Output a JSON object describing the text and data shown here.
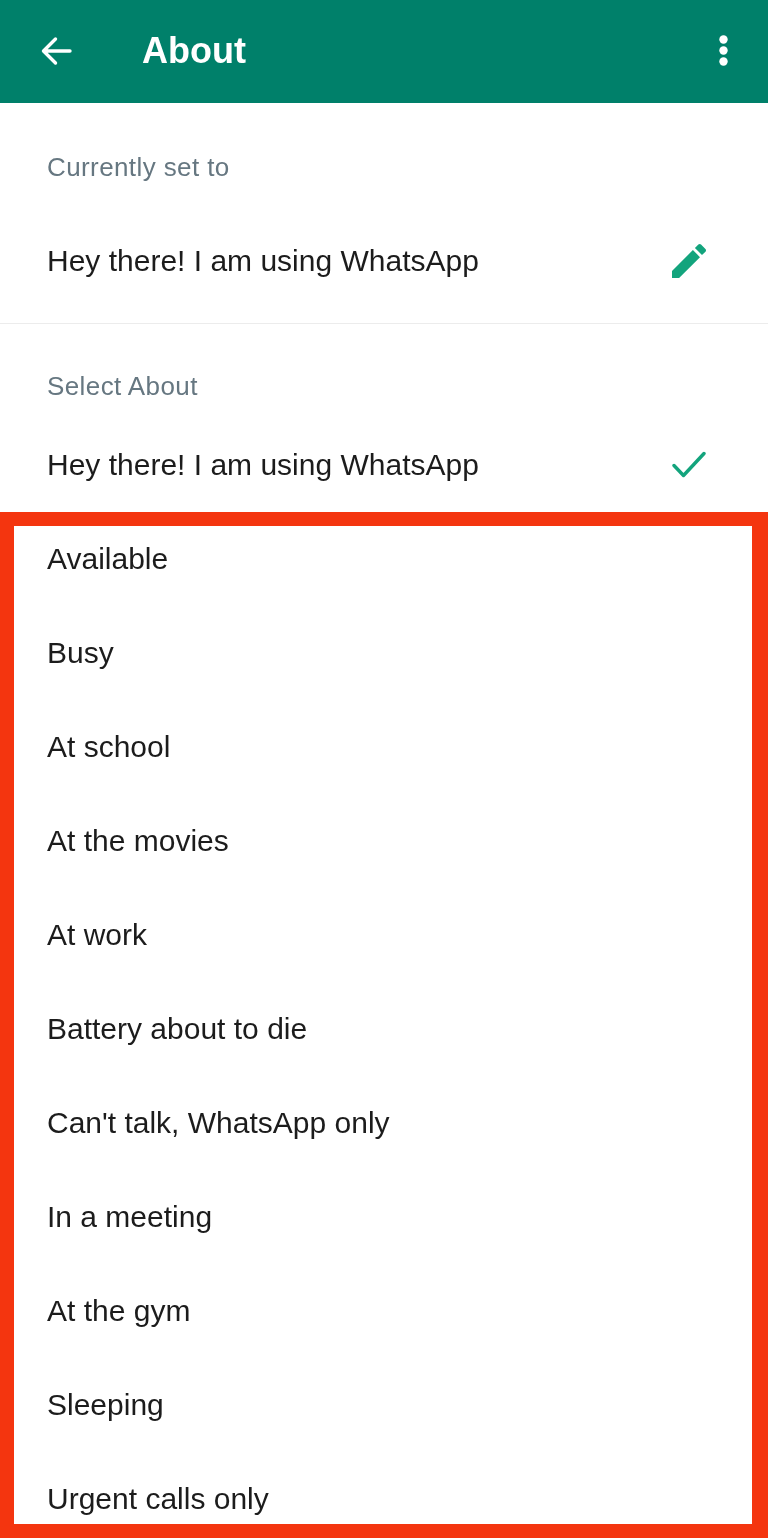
{
  "app_bar": {
    "title": "About"
  },
  "current": {
    "label": "Currently set to",
    "text": "Hey there! I am using WhatsApp"
  },
  "select": {
    "label": "Select About",
    "options": [
      {
        "text": "Hey there! I am using WhatsApp",
        "selected": true
      }
    ],
    "highlighted_options": [
      {
        "text": "Available",
        "selected": false
      },
      {
        "text": "Busy",
        "selected": false
      },
      {
        "text": "At school",
        "selected": false
      },
      {
        "text": "At the movies",
        "selected": false
      },
      {
        "text": "At work",
        "selected": false
      },
      {
        "text": "Battery about to die",
        "selected": false
      },
      {
        "text": "Can't talk, WhatsApp only",
        "selected": false
      },
      {
        "text": "In a meeting",
        "selected": false
      },
      {
        "text": "At the gym",
        "selected": false
      },
      {
        "text": "Sleeping",
        "selected": false
      },
      {
        "text": "Urgent calls only",
        "selected": false
      }
    ]
  }
}
